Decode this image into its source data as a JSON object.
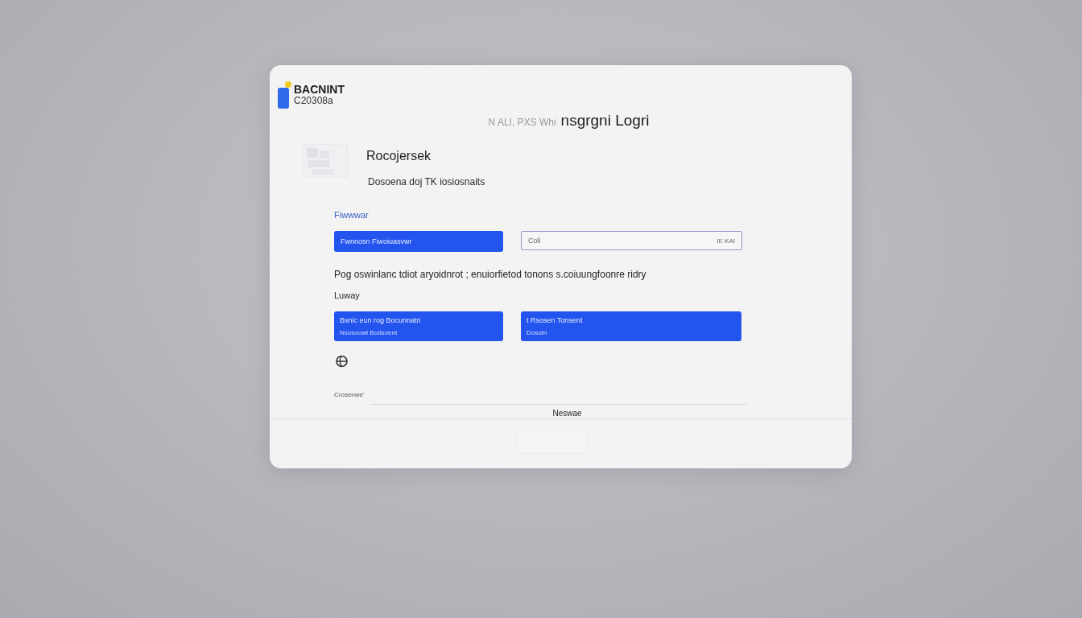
{
  "logo": {
    "name": "BACNINT",
    "code": "C20308a"
  },
  "title": {
    "prefix": "N ALI, PXS Whi",
    "main": "nsgrgni Logri"
  },
  "section": {
    "heading": "Rocojersek",
    "subtitle": "Dosoena doj  TK iosiosnaits"
  },
  "field_label": "Fiwwwar",
  "primary_button": "Fwnnosn Fiwoiuasvwr",
  "input": {
    "value": "Coli",
    "suffix": "IE KAI"
  },
  "description": "Pog oswinlanc tdiot aryoidnrot ; enuiorfietod tonons s.coiuungfoonre ridry",
  "options_label": "Luway",
  "options": [
    {
      "title": "Bsnic eun rog Bocunnatn",
      "subtitle": "Nsosoowt Bodsoent"
    },
    {
      "title": "t Rsosen Tonsent",
      "subtitle": "Dosotn"
    }
  ],
  "signature_label": "Crosenwe'",
  "footer_text": "Neswae"
}
